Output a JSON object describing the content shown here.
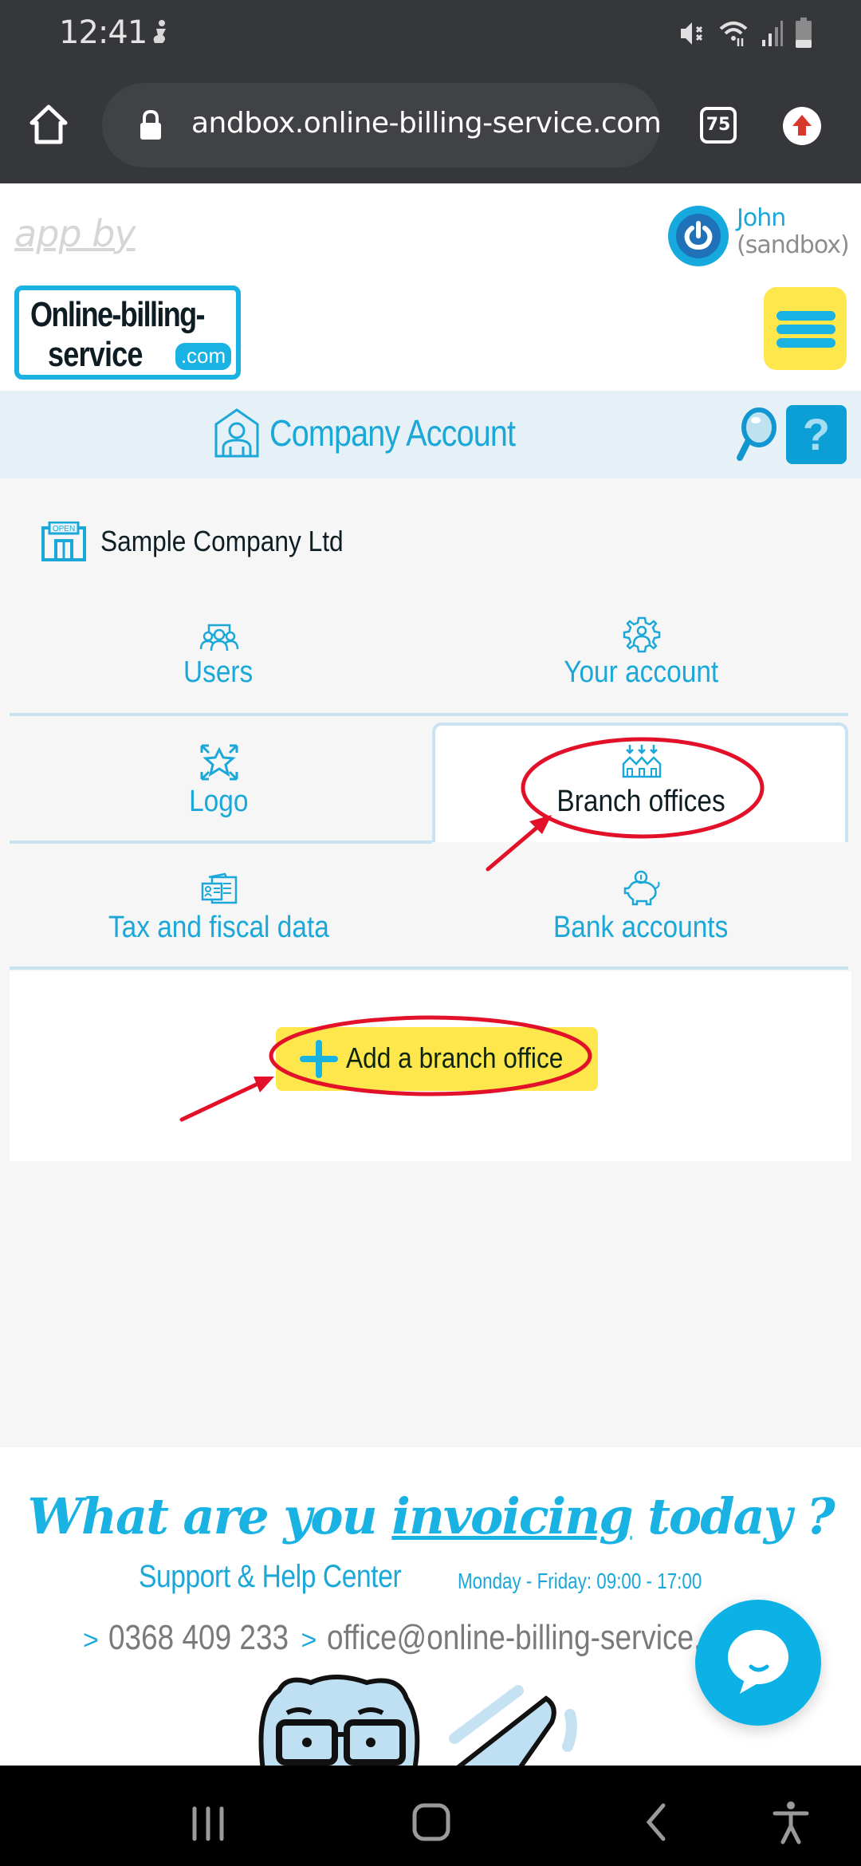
{
  "status_bar": {
    "time": "12:41",
    "icons": [
      "accessibility-notification-icon",
      "mute-icon",
      "wifi-icon",
      "signal-icon",
      "battery-icon"
    ]
  },
  "browser": {
    "url": "andbox.online-billing-service.com",
    "tabs_count": "75",
    "icons": [
      "home-icon",
      "lock-icon",
      "tabs-icon",
      "update-icon"
    ]
  },
  "header": {
    "app_by": "app by",
    "logo_line1": "Online-billing-",
    "logo_line2": "service",
    "logo_com": ".com",
    "user_name": "John",
    "user_env": "(sandbox)",
    "colors": {
      "brand_blue": "#1ba8d8",
      "brand_yellow": "#fde74c"
    }
  },
  "title_bar": {
    "title": "Company Account",
    "help_label": "?"
  },
  "company": {
    "name": "Sample Company Ltd",
    "icon_text": "OPEN"
  },
  "tiles": [
    {
      "label": "Users",
      "icon": "users-icon",
      "active": false
    },
    {
      "label": "Your account",
      "icon": "account-settings-icon",
      "active": false
    },
    {
      "label": "Logo",
      "icon": "logo-expand-icon",
      "active": false
    },
    {
      "label": "Branch offices",
      "icon": "branch-offices-icon",
      "active": true
    },
    {
      "label": "Tax and fiscal data",
      "icon": "tax-id-card-icon",
      "active": false
    },
    {
      "label": "Bank accounts",
      "icon": "piggy-bank-icon",
      "active": false
    }
  ],
  "panel": {
    "add_button_label": "Add a branch office"
  },
  "footer": {
    "slogan_pre": "What are you ",
    "slogan_underlined": "invoicing",
    "slogan_post": " today ?",
    "support_title": "Support & Help Center",
    "support_hours": "Monday - Friday: 09:00 - 17:00",
    "phone": "0368 409 233",
    "email": "office@online-billing-service.com",
    "chevron": ">"
  },
  "annotations": {
    "color": "#e3102a",
    "highlights": [
      "Branch offices",
      "Add a branch office"
    ]
  }
}
